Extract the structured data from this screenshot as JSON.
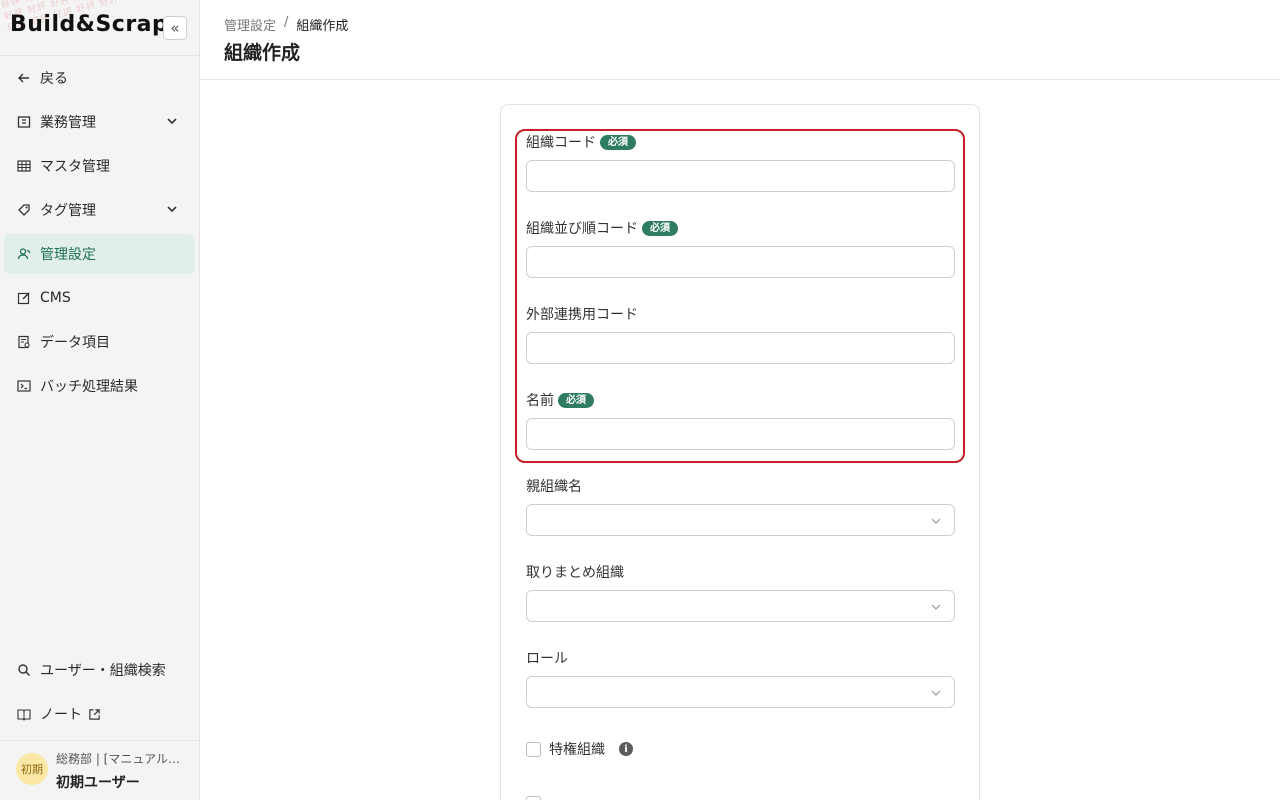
{
  "brand": {
    "logo": "Build&Scrap",
    "watermark": "好評 好評 好評 好評 好評 好評 好評 好評 好評 好評"
  },
  "sidebar": {
    "collapse_glyph": "«",
    "items": [
      {
        "label": "戻る",
        "icon": "arrow-left-icon"
      },
      {
        "label": "業務管理",
        "icon": "business-icon",
        "expandable": true
      },
      {
        "label": "マスタ管理",
        "icon": "table-icon"
      },
      {
        "label": "タグ管理",
        "icon": "tag-icon",
        "expandable": true
      },
      {
        "label": "管理設定",
        "icon": "people-icon",
        "active": true
      },
      {
        "label": "CMS",
        "icon": "edit-icon"
      },
      {
        "label": "データ項目",
        "icon": "data-icon"
      },
      {
        "label": "バッチ処理結果",
        "icon": "terminal-icon"
      }
    ],
    "bottom_items": [
      {
        "label": "ユーザー・組織検索",
        "icon": "search-icon"
      },
      {
        "label": "ノート",
        "icon": "book-icon",
        "external": true
      }
    ],
    "user": {
      "avatar_text": "初期",
      "org": "総務部 | [マニュアル…",
      "name": "初期ユーザー"
    }
  },
  "header": {
    "breadcrumb": [
      "管理設定",
      "組織作成"
    ],
    "breadcrumb_sep": "/",
    "title": "組織作成"
  },
  "form": {
    "required_badge": "必須",
    "fields": [
      {
        "label": "組織コード",
        "required": true,
        "value": ""
      },
      {
        "label": "組織並び順コード",
        "required": true,
        "value": ""
      },
      {
        "label": "外部連携用コード",
        "required": false,
        "value": ""
      },
      {
        "label": "名前",
        "required": true,
        "value": ""
      }
    ],
    "selects": [
      {
        "label": "親組織名",
        "value": ""
      },
      {
        "label": "取りまとめ組織",
        "value": ""
      },
      {
        "label": "ロール",
        "value": ""
      }
    ],
    "checkboxes": [
      {
        "label": "特権組織",
        "checked": false,
        "info": true
      },
      {
        "label": "…",
        "checked": false
      }
    ]
  },
  "colors": {
    "accent": "#2f7d60",
    "active_bg": "#e2efe9",
    "highlight": "#c8202b"
  }
}
